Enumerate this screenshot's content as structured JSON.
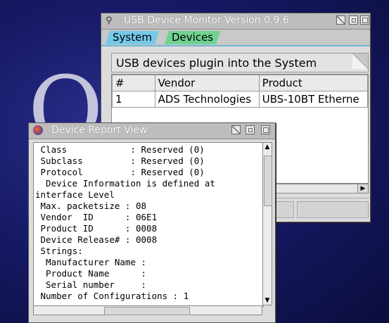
{
  "desktop": {
    "logo_text": "OS"
  },
  "main_window": {
    "title": "USB Device Monitor Version 0.9.6",
    "tabs": [
      {
        "label": "System"
      },
      {
        "label": "Devices"
      }
    ],
    "panel_title": "USB devices plugin into the System",
    "table": {
      "headers": [
        "#",
        "Vendor",
        "Product"
      ],
      "rows": [
        [
          "1",
          "ADS Technologies",
          "UBS-10BT Etherne"
        ]
      ]
    }
  },
  "report_window": {
    "title": "Device Report View",
    "lines": [
      " Class            : Reserved (0)",
      " Subclass         : Reserved (0)",
      " Protocol         : Reserved (0)",
      "  Device Information is defined at",
      "interface Level",
      " Max. packetsize : 08",
      " Vendor  ID      : 06E1",
      " Product ID      : 0008",
      " Device Release# : 0008",
      " Strings:",
      "  Manufacturer Name :",
      "  Product Name      :",
      "  Serial number     :",
      " Number of Configurations : 1"
    ]
  },
  "colors": {
    "tab_system": "#75c8e8",
    "tab_devices": "#6fd38f",
    "desktop": "#161a66"
  }
}
